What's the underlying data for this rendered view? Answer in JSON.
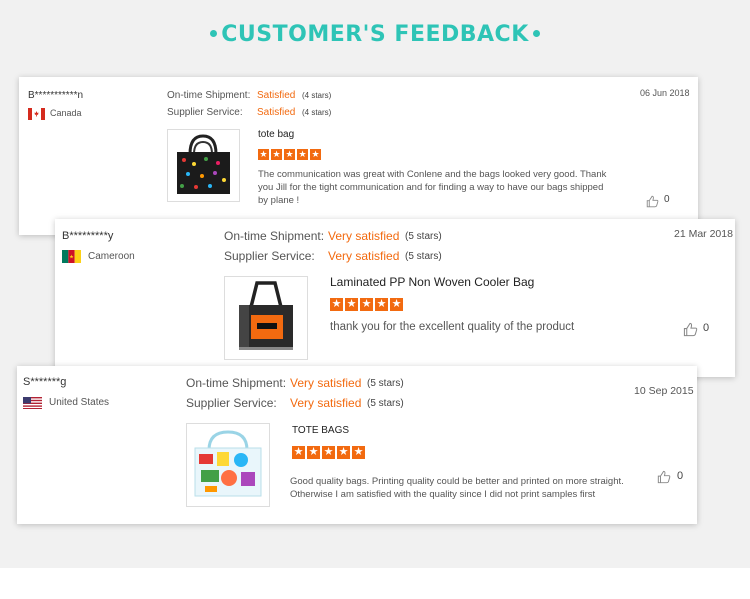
{
  "heading": {
    "title": "CUSTOMER'S FEEDBACK"
  },
  "labels": {
    "shipment": "On-time Shipment:",
    "service": "Supplier Service:"
  },
  "reviews": [
    {
      "name": "B***********n",
      "country": "Canada",
      "flag": "canada-flag",
      "date": "06 Jun 2018",
      "shipment_status": "Satisfied",
      "shipment_stars": "(4 stars)",
      "service_status": "Satisfied",
      "service_stars": "(4 stars)",
      "product_title": "tote bag",
      "rating": 5,
      "comment": "The communication was great with Conlene and the bags looked very good. Thank you Jill for the tight communication and for finding a way to have our bags shipped by plane !",
      "likes": "0"
    },
    {
      "name": "B*********y",
      "country": "Cameroon",
      "flag": "cameroon-flag",
      "date": "21 Mar 2018",
      "shipment_status": "Very satisfied",
      "shipment_stars": "(5 stars)",
      "service_status": "Very satisfied",
      "service_stars": "(5 stars)",
      "product_title": "Laminated PP Non Woven Cooler Bag",
      "rating": 5,
      "comment": "thank you for the excellent quality of the product",
      "likes": "0"
    },
    {
      "name": "S*******g",
      "country": "United States",
      "flag": "usa-flag",
      "date": "10 Sep 2015",
      "shipment_status": "Very satisfied",
      "shipment_stars": "(5 stars)",
      "service_status": "Very satisfied",
      "service_stars": "(5 stars)",
      "product_title": "TOTE BAGS",
      "rating": 5,
      "comment": "Good quality bags. Printing quality could be better and printed on more straight. Otherwise I am satisfied with the quality since I did not print samples first",
      "likes": "0"
    }
  ],
  "colors": {
    "accent": "#2ec4b6",
    "status": "#f26a10"
  }
}
